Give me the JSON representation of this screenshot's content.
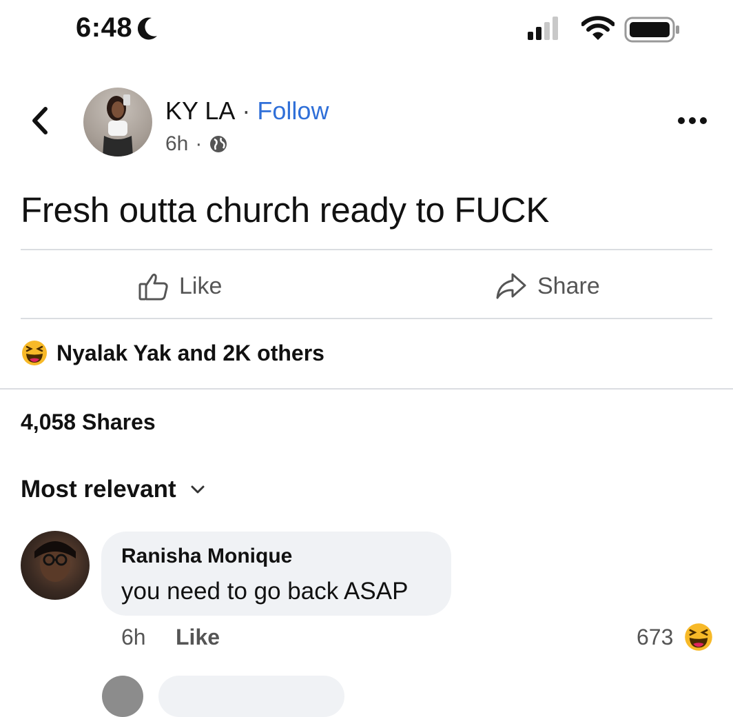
{
  "status_bar": {
    "time": "6:48"
  },
  "post": {
    "author": "KY LA",
    "separator": "·",
    "follow_label": "Follow",
    "age": "6h",
    "meta_separator": "·",
    "text": "Fresh outta church ready to FUCK",
    "actions": {
      "like": "Like",
      "share": "Share"
    },
    "reactions_text": "Nyalak Yak and 2K others",
    "shares_text": "4,058 Shares"
  },
  "comments": {
    "sort_label": "Most relevant",
    "items": [
      {
        "author": "Ranisha Monique",
        "text": "you need to go back ASAP",
        "age": "6h",
        "like_label": "Like",
        "reaction_count": "673"
      }
    ]
  },
  "colors": {
    "link_blue": "#2f6fd8",
    "bubble_gray": "#f0f2f5",
    "divider": "#dadde1",
    "haha_yellow": "#f7b928"
  },
  "icons": [
    "moon-icon",
    "cellular-signal-icon",
    "wifi-icon",
    "battery-icon",
    "back-chevron-icon",
    "globe-icon",
    "more-options-icon",
    "like-thumb-icon",
    "share-arrow-icon",
    "haha-reaction-icon",
    "chevron-down-icon"
  ]
}
